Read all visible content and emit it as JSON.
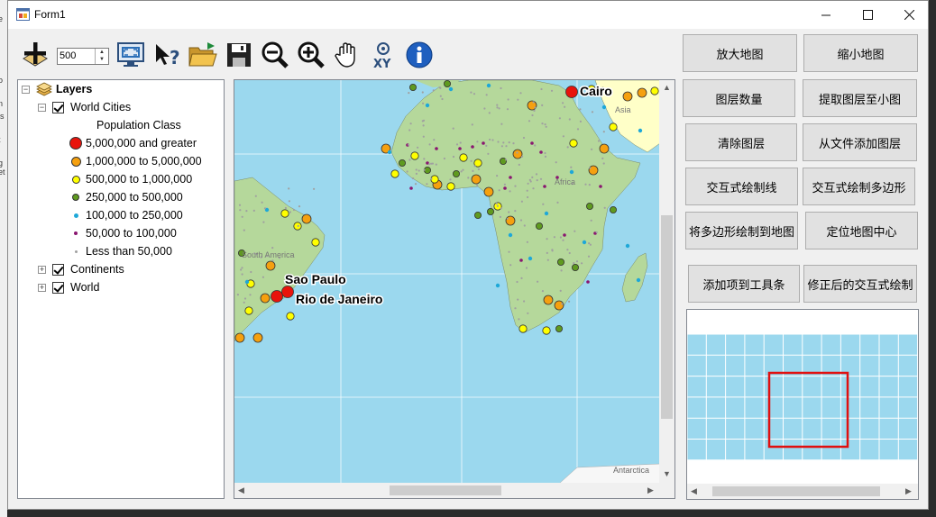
{
  "window": {
    "title": "Form1"
  },
  "toolbar": {
    "zoom_value": "500",
    "tools": [
      "add-data-icon",
      "navigate-icon",
      "full-extent-icon",
      "whats-this-icon",
      "open-folder-icon",
      "save-icon",
      "zoom-out-icon",
      "zoom-in-icon",
      "pan-hand-icon",
      "goto-xy-icon",
      "identify-icon"
    ]
  },
  "toc": {
    "root": "Layers",
    "layers": [
      {
        "label": "World Cities",
        "checked": true,
        "expanded": true
      },
      {
        "label": "Continents",
        "checked": true,
        "expanded": false
      },
      {
        "label": "World",
        "checked": true,
        "expanded": false
      }
    ],
    "legend_heading": "Population Class",
    "legend": [
      {
        "label": "5,000,000 and greater",
        "color": "#e8140c"
      },
      {
        "label": "1,000,000 to 5,000,000",
        "color": "#f5a00f"
      },
      {
        "label": "500,000 to 1,000,000",
        "color": "#ffff00"
      },
      {
        "label": "250,000 to 500,000",
        "color": "#5f9a1f"
      },
      {
        "label": "100,000 to 250,000",
        "color": "#1ea8d8"
      },
      {
        "label": "50,000 to 100,000",
        "color": "#8a1670"
      },
      {
        "label": "Less than 50,000",
        "color": "#a0a0a0"
      }
    ]
  },
  "map": {
    "land_color": "#b5d89b",
    "water_color": "#9bd8ee",
    "asia_color": "#ffffc8",
    "labels": {
      "cairo": "Cairo",
      "sao_paulo": "Sao Paulo",
      "rio": "Rio de Janeiro",
      "africa": "Africa",
      "asia": "Asia",
      "south_america": "South America",
      "antarctica": "Antarctica"
    }
  },
  "buttons": {
    "zoom_in_map": "放大地图",
    "zoom_out_map": "缩小地图",
    "layer_count": "图层数量",
    "extract_to_overview": "提取图层至小图",
    "clear_layers": "清除图层",
    "add_layer_from_file": "从文件添加图层",
    "draw_line": "交互式绘制线",
    "draw_polygon": "交互式绘制多边形",
    "polygon_to_map": "将多边形绘制到地图",
    "center_map": "定位地图中心",
    "add_to_toolbar": "添加项到工具条",
    "modified_draw": "修正后的交互式绘制"
  },
  "overview": {
    "extent_color": "#e01010"
  }
}
